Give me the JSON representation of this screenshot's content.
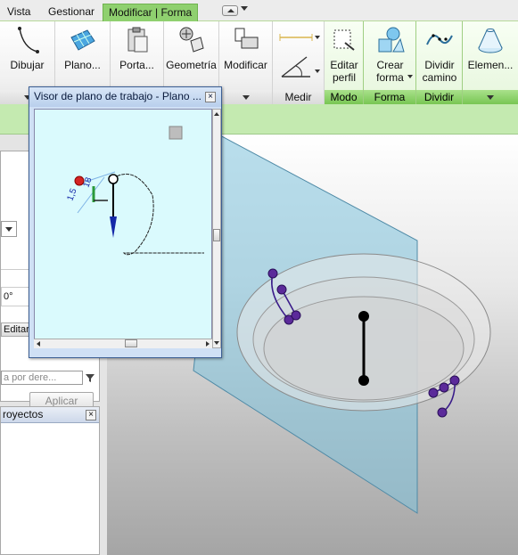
{
  "menu": {
    "tabs": [
      "Vista",
      "Gestionar",
      "Modificar | Forma"
    ],
    "active_tab": "Modificar | Forma"
  },
  "ribbon": {
    "buttons": {
      "dibujar": "Dibujar",
      "plano": "Plano...",
      "porta": "Porta...",
      "geometria": "Geometría",
      "modificar": "Modificar",
      "editar_perfil_1": "Editar",
      "editar_perfil_2": "perfil",
      "crear_forma_1": "Crear",
      "crear_forma_2": "forma",
      "dividir_camino_1": "Dividir",
      "dividir_camino_2": "camino",
      "elementos": "Elemen..."
    },
    "panels": {
      "medir": "Medir",
      "modo": "Modo",
      "forma": "Forma",
      "dividir": "Dividir"
    }
  },
  "left": {
    "angle_value": "0°",
    "edit_label": "Editar",
    "filter_text": "a por dere...",
    "apply_label": "Aplicar",
    "projects_title": "royectos"
  },
  "viewer": {
    "title": "Visor de plano de trabajo - Plano ...",
    "dim_label_1": "1,5",
    "dim_label_2": "18"
  },
  "colors": {
    "ribbon_green": "#8fd06f",
    "options_bar": "#c4eab0",
    "viewer_bg": "#dafafd",
    "plane_blue": "#7fc3dc"
  }
}
